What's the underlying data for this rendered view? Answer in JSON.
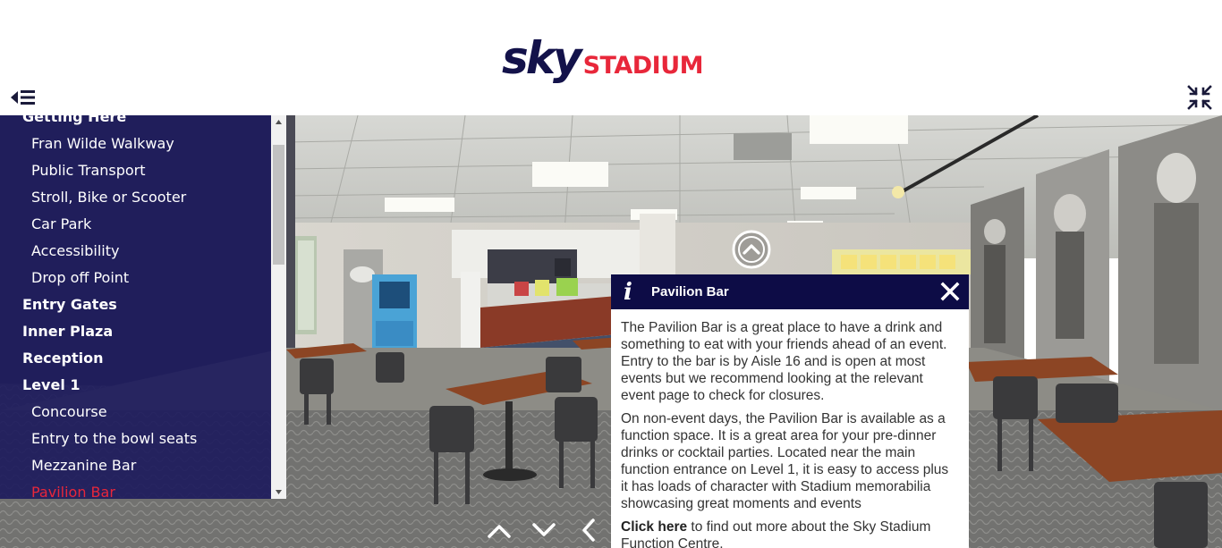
{
  "header": {
    "logo_sky": "sky",
    "logo_stadium": "STADIUM",
    "brand_navy": "#13124a",
    "brand_red": "#e8273a"
  },
  "sidebar": {
    "items": [
      {
        "label": "Getting Here",
        "level": "top",
        "active": false
      },
      {
        "label": "Fran Wilde Walkway",
        "level": "sub",
        "active": false
      },
      {
        "label": "Public Transport",
        "level": "sub",
        "active": false
      },
      {
        "label": "Stroll, Bike or Scooter",
        "level": "sub",
        "active": false
      },
      {
        "label": "Car Park",
        "level": "sub",
        "active": false
      },
      {
        "label": "Accessibility",
        "level": "sub",
        "active": false
      },
      {
        "label": "Drop off Point",
        "level": "sub",
        "active": false
      },
      {
        "label": "Entry Gates",
        "level": "top",
        "active": false
      },
      {
        "label": "Inner Plaza",
        "level": "top",
        "active": false
      },
      {
        "label": "Reception",
        "level": "top",
        "active": false
      },
      {
        "label": "Level 1",
        "level": "top",
        "active": false
      },
      {
        "label": "Concourse",
        "level": "sub",
        "active": false
      },
      {
        "label": "Entry to the bowl seats",
        "level": "sub",
        "active": false
      },
      {
        "label": "Mezzanine Bar",
        "level": "sub",
        "active": false
      },
      {
        "label": "Pavilion Bar",
        "level": "sub",
        "active": true
      }
    ]
  },
  "info": {
    "icon": "i",
    "title": "Pavilion Bar",
    "paragraph1": "The Pavilion Bar is a great place to have a drink and something to eat with your friends ahead of an event. Entry to the bar is by Aisle 16 and is open at most events but we recommend looking at the relevant event page to check for closures.",
    "paragraph2": "On non-event days, the Pavilion Bar is available as a function space. It is a great area for your pre-dinner drinks or cocktail parties. Located near the main function entrance on Level 1, it is easy to access plus it has loads of character with Stadium memorabilia showcasing great moments and events",
    "link_label": "Click here",
    "link_suffix": " to find out more about the Sky Stadium Function Centre."
  },
  "icons": {
    "menu": "menu-collapse-icon",
    "fullscreen": "exit-fullscreen-icon",
    "hotspot": "chevron-up-circle-icon",
    "close": "close-icon",
    "nav_up": "chevron-up-icon",
    "nav_down": "chevron-down-icon",
    "nav_left": "chevron-left-icon"
  }
}
